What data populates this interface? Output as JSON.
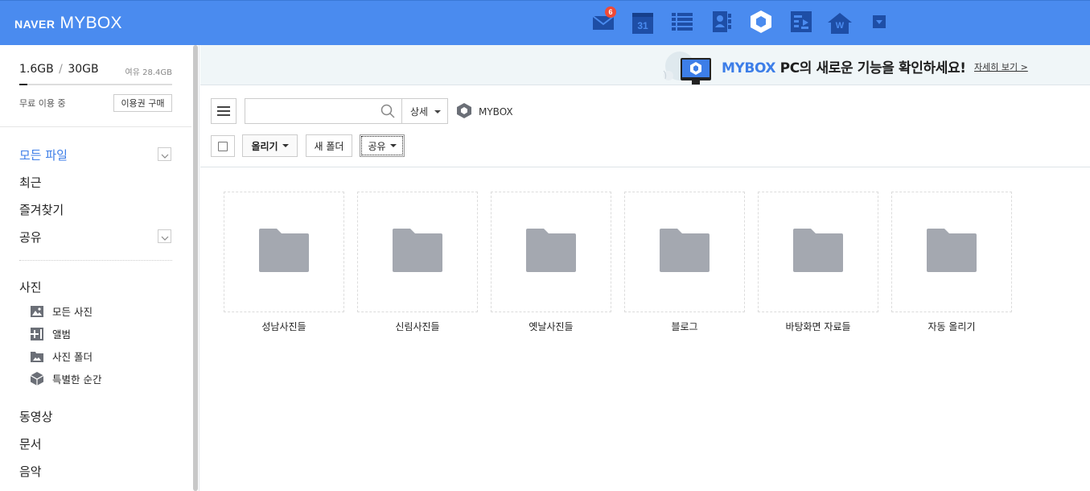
{
  "app": {
    "brand": "NAVER",
    "title": "MYBOX"
  },
  "header": {
    "services": [
      {
        "name": "mail",
        "icon": "mail-icon",
        "badge": "6"
      },
      {
        "name": "calendar",
        "icon": "calendar-icon",
        "text": "31"
      },
      {
        "name": "memo",
        "icon": "list-icon"
      },
      {
        "name": "contacts",
        "icon": "contacts-icon"
      },
      {
        "name": "mybox",
        "icon": "mybox-cube-icon",
        "active": true
      },
      {
        "name": "office",
        "icon": "office-icon"
      },
      {
        "name": "home",
        "icon": "home-icon",
        "text": "W"
      },
      {
        "name": "more",
        "icon": "dropdown-icon"
      }
    ]
  },
  "sidebar": {
    "storage": {
      "used": "1.6GB",
      "separator": "/",
      "total": "30GB",
      "free": "여유 28.4GB",
      "used_fraction": 0.053
    },
    "plan_label": "무료 이용 중",
    "buy_label": "이용권 구매",
    "nav": [
      {
        "label": "모든 파일",
        "active": true,
        "expandable": true
      },
      {
        "label": "최근"
      },
      {
        "label": "즐겨찾기"
      },
      {
        "label": "공유",
        "expandable": true
      }
    ],
    "photo": {
      "label": "사진",
      "items": [
        {
          "label": "모든 사진",
          "icon": "image-icon"
        },
        {
          "label": "앨범",
          "icon": "album-plus-icon"
        },
        {
          "label": "사진 폴더",
          "icon": "photo-folder-icon"
        },
        {
          "label": "특별한 순간",
          "icon": "cube-icon"
        }
      ]
    },
    "more": [
      {
        "label": "동영상"
      },
      {
        "label": "문서"
      },
      {
        "label": "음악"
      }
    ]
  },
  "promo": {
    "highlight": "MYBOX",
    "text": " PC의 새로운 기능을 확인하세요!",
    "link": "자세히 보기 >"
  },
  "toolbar": {
    "search": {
      "value": "",
      "placeholder": ""
    },
    "detail_label": "상세",
    "path_label": "MYBOX",
    "upload_label": "올리기",
    "new_folder_label": "새 폴더",
    "share_label": "공유"
  },
  "folders": [
    {
      "name": "성남사진들"
    },
    {
      "name": "신림사진들"
    },
    {
      "name": "옛날사진들"
    },
    {
      "name": "블로그"
    },
    {
      "name": "바탕화면 자료들"
    },
    {
      "name": "자동 올리기"
    }
  ],
  "colors": {
    "header_bg": "#4a8bef",
    "accent": "#3d7ee8",
    "badge": "#f04a36",
    "folder_icon": "#a4a8b0",
    "promo_bg": "#f0f6f8"
  }
}
